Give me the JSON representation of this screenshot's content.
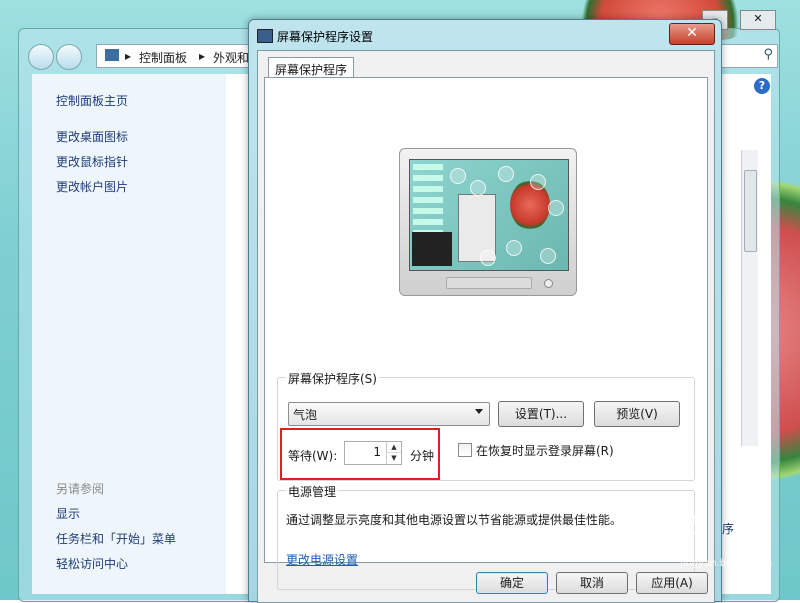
{
  "control_panel": {
    "breadcrumb": [
      "控制面板",
      "外观和"
    ],
    "left_links": [
      "控制面板主页",
      "更改桌面图标",
      "更改鼠标指针",
      "更改帐户图片"
    ],
    "see_also_title": "另请参阅",
    "see_also_links": [
      "显示",
      "任务栏和「开始」菜单",
      "轻松访问中心"
    ],
    "right_partial_link": "序"
  },
  "dialog": {
    "title": "屏幕保护程序设置",
    "close_glyph": "✕",
    "tab": "屏幕保护程序",
    "screensaver_group": {
      "legend": "屏幕保护程序(S)",
      "selected": "气泡",
      "settings_button": "设置(T)...",
      "preview_button": "预览(V)",
      "wait_label": "等待(W):",
      "wait_value": "1",
      "wait_unit": "分钟",
      "resume_checkbox_label": "在恢复时显示登录屏幕(R)",
      "resume_checked": false
    },
    "power_group": {
      "legend": "电源管理",
      "description": "通过调整显示亮度和其他电源设置以节省能源或提供最佳性能。",
      "link": "更改电源设置"
    },
    "footer": {
      "ok": "确定",
      "cancel": "取消",
      "apply": "应用(A)"
    }
  },
  "watermark": {
    "brand": "Bai 经验",
    "url": "jingyan.baidu.com"
  },
  "colors": {
    "highlight_box": "#e02020",
    "link": "#1e5cb3",
    "close_button": "#c4402a"
  }
}
